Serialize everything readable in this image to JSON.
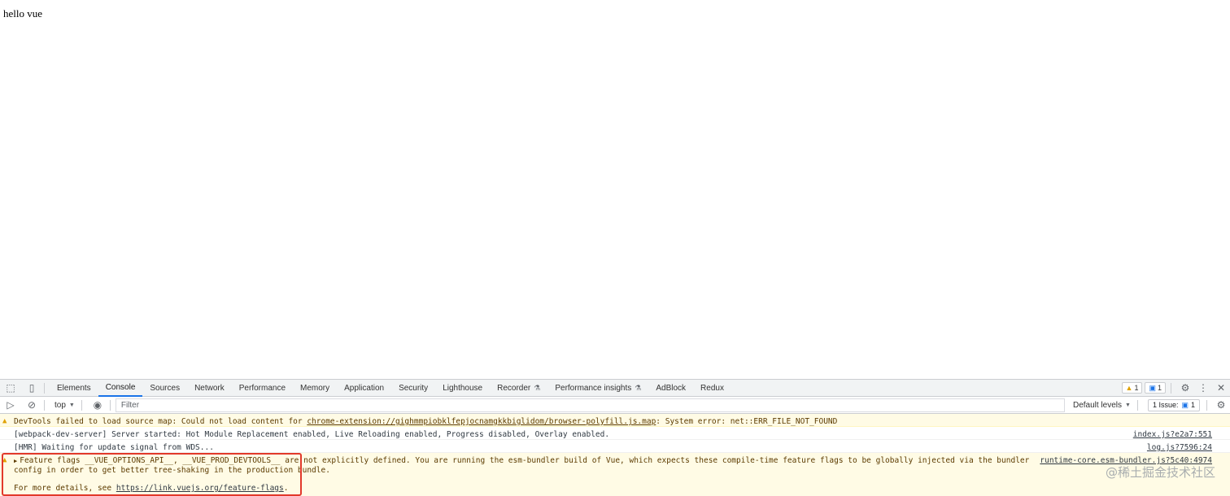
{
  "page": {
    "text": "hello vue"
  },
  "devtools": {
    "tabs": [
      "Elements",
      "Console",
      "Sources",
      "Network",
      "Performance",
      "Memory",
      "Application",
      "Security",
      "Lighthouse",
      "Recorder",
      "Performance insights",
      "AdBlock",
      "Redux"
    ],
    "active_tab": "Console",
    "warning_count": "1",
    "message_count": "1",
    "toolbar": {
      "context": "top",
      "filter_placeholder": "Filter",
      "levels": "Default levels",
      "issues_label": "1 Issue:",
      "issues_count": "1"
    },
    "messages": [
      {
        "type": "warning",
        "prefix": "DevTools failed to load source map: Could not load content for ",
        "link": "chrome-extension://gighmmpiobklfepjocnamgkkbiglidom/browser-polyfill.js.map",
        "suffix": ": System error: net::ERR_FILE_NOT_FOUND"
      },
      {
        "type": "log",
        "text": "[webpack-dev-server] Server started: Hot Module Replacement enabled, Live Reloading enabled, Progress disabled, Overlay enabled.",
        "source": "index.js?e2a7:551"
      },
      {
        "type": "log",
        "text": "[HMR] Waiting for update signal from WDS...",
        "source": "log.js?7596:24"
      },
      {
        "type": "warning",
        "line1": "Feature flags __VUE_OPTIONS_API__, __VUE_PROD_DEVTOOLS__ are not explicitly defined. You are running the esm-bundler build of Vue, which expects these compile-time feature flags to be globally injected via the bundler",
        "line2": "config in order to get better tree-shaking in the production bundle.",
        "details_prefix": "For more details, see ",
        "details_link": "https://link.vuejs.org/feature-flags",
        "details_suffix": ".",
        "source": "runtime-core.esm-bundler.js?5c40:4974"
      }
    ]
  },
  "watermark": "@稀土掘金技术社区",
  "colors": {
    "highlight": "#e2392b",
    "accent": "#1a73e8",
    "warning": "#e0a100"
  }
}
